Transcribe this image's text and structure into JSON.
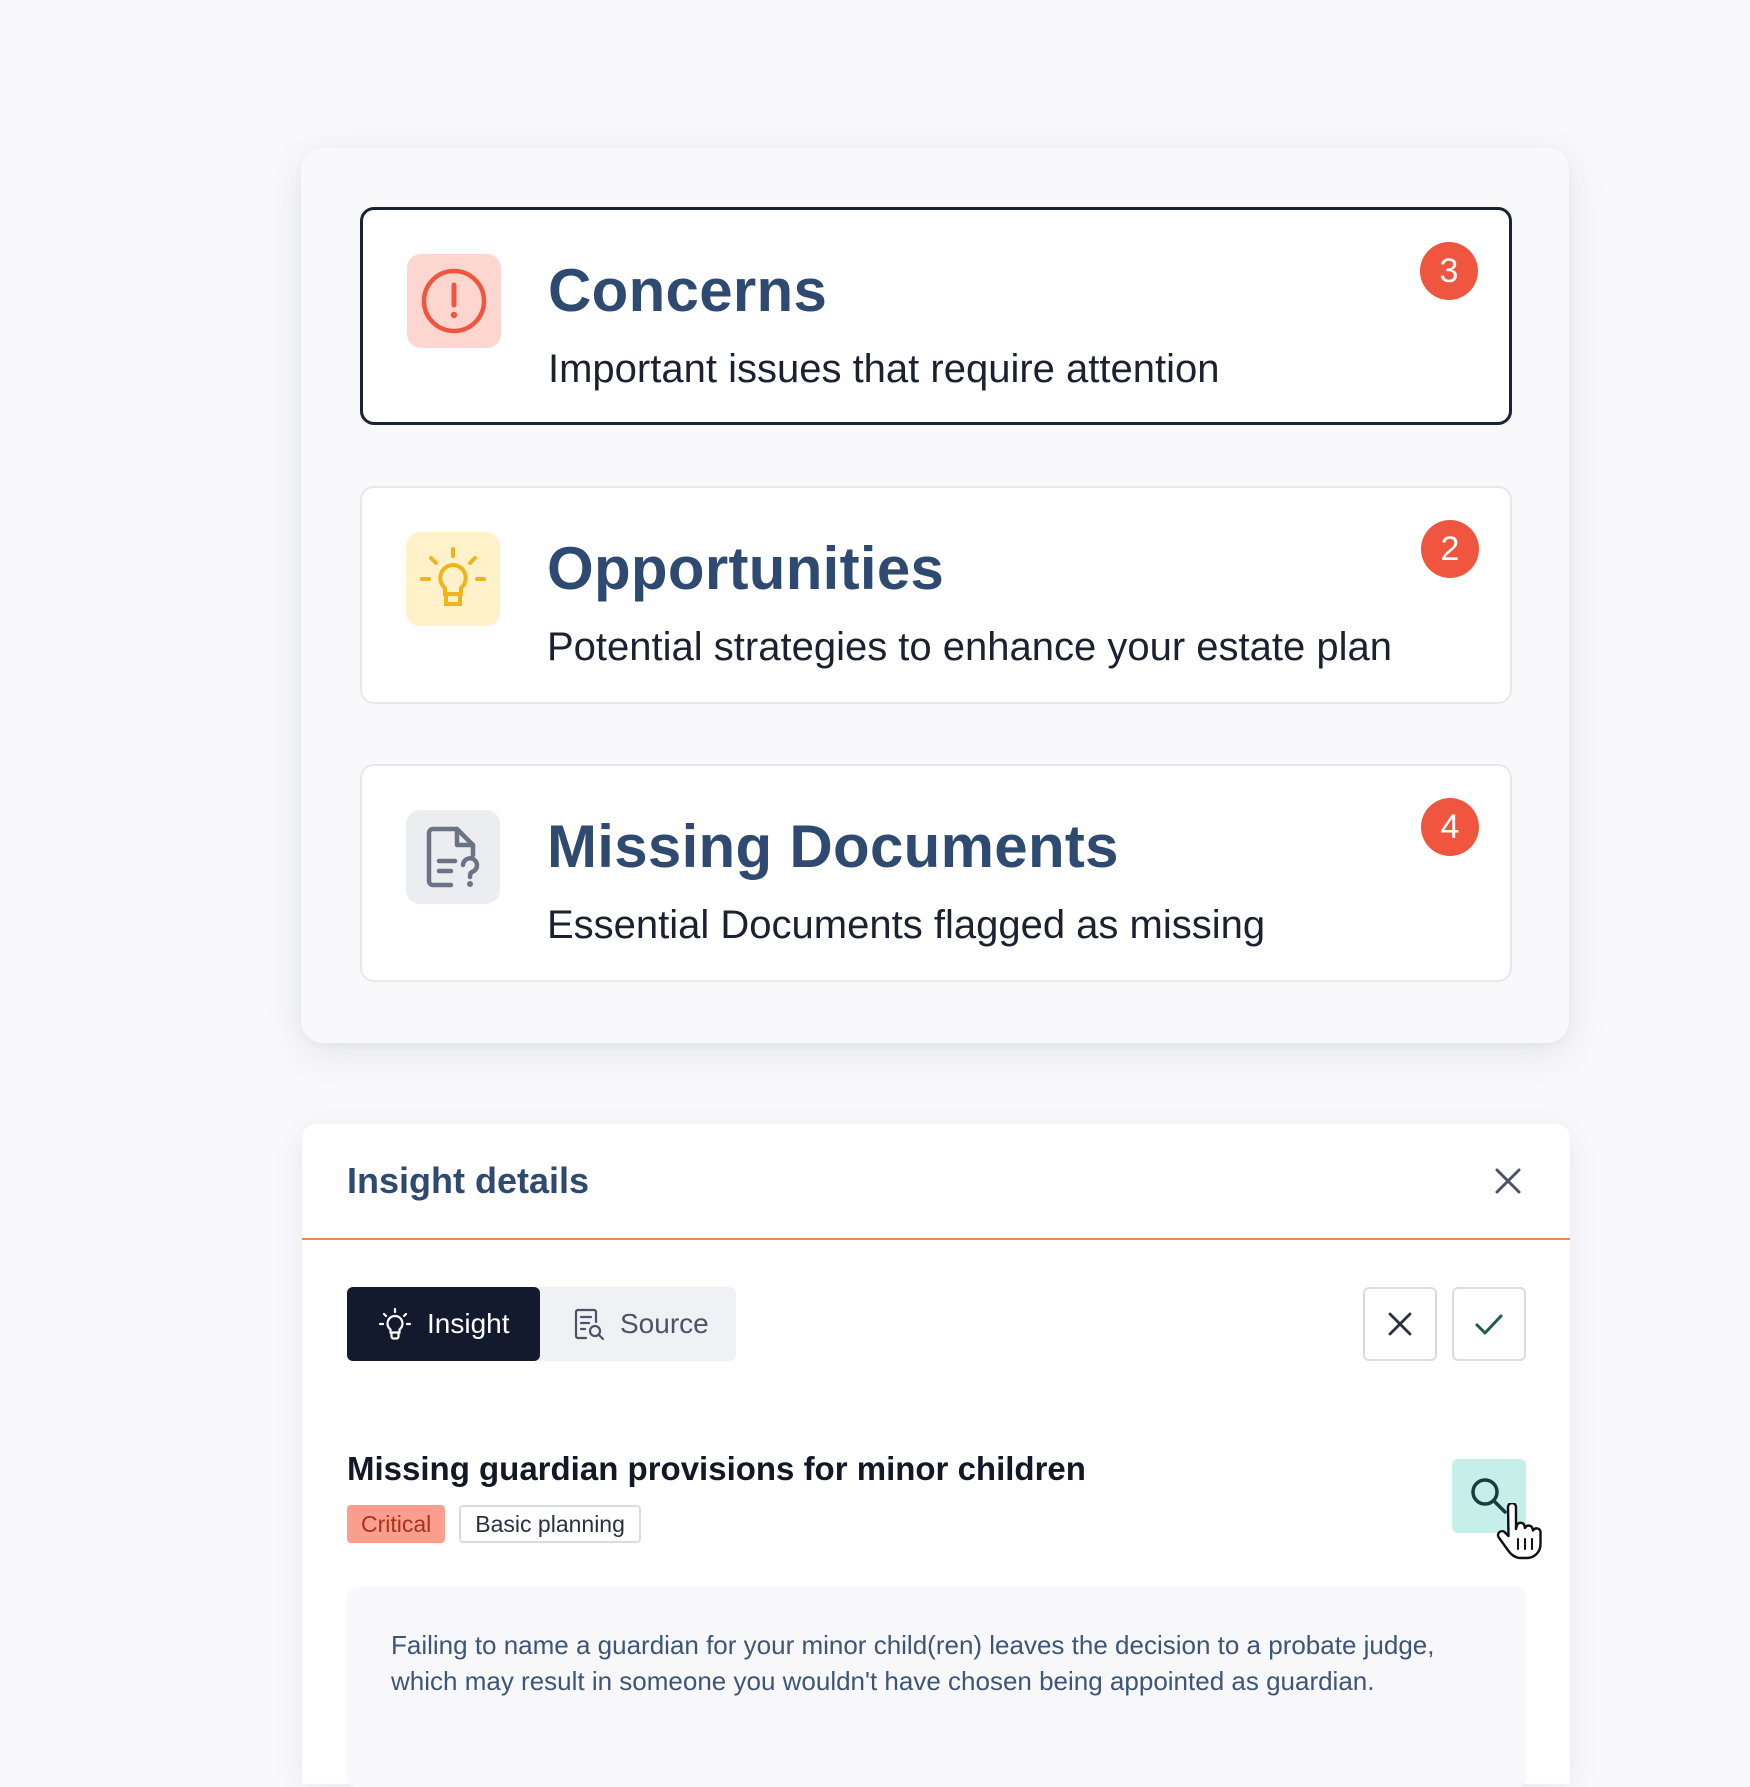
{
  "categories": [
    {
      "title": "Concerns",
      "description": "Important issues that require attention",
      "count": "3",
      "icon": "alert-circle-icon",
      "icon_bg": "#fdd7cf",
      "icon_color": "#f0553f",
      "selected": true
    },
    {
      "title": "Opportunities",
      "description": "Potential strategies to enhance your estate plan",
      "count": "2",
      "icon": "lightbulb-icon",
      "icon_bg": "#fff1c9",
      "icon_color": "#f2b21c",
      "selected": false
    },
    {
      "title": "Missing Documents",
      "description": "Essential Documents flagged as missing",
      "count": "4",
      "icon": "document-question-icon",
      "icon_bg": "#ebedf1",
      "icon_color": "#6b7385",
      "selected": false
    }
  ],
  "details": {
    "title": "Insight details",
    "tabs": [
      {
        "label": "Insight",
        "icon": "lightbulb-icon",
        "active": true
      },
      {
        "label": "Source",
        "icon": "document-search-icon",
        "active": false
      }
    ],
    "actions": {
      "reject_icon": "x-icon",
      "accept_icon": "check-icon"
    },
    "insight": {
      "title": "Missing guardian provisions for minor children",
      "tags": [
        "Critical",
        "Basic planning"
      ],
      "explanation": "Failing to name a guardian for your minor child(ren) leaves the decision to a probate judge, which may result in someone you wouldn't have chosen being appointed as guardian."
    }
  },
  "colors": {
    "badge": "#f0553f",
    "title": "#2f4a70",
    "accent_line": "#ec8a66",
    "active_tab": "#131a2e",
    "search_bg": "#c6efe9",
    "critical_tag": "#fb9e8d"
  }
}
